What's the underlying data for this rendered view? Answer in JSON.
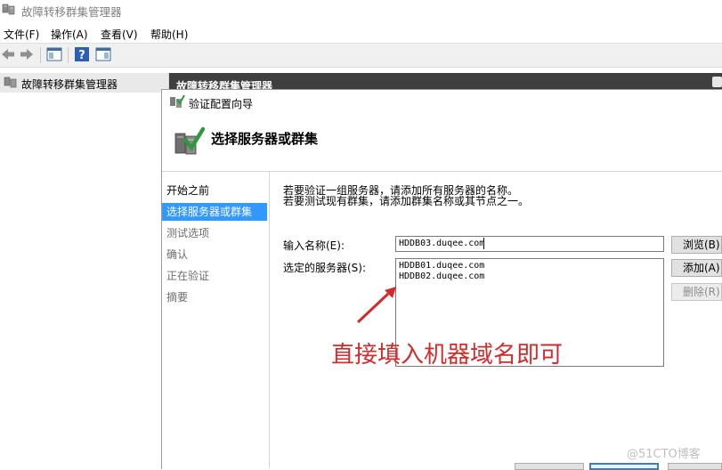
{
  "window": {
    "title": "故障转移群集管理器"
  },
  "menu": {
    "items": [
      "文件(F)",
      "操作(A)",
      "查看(V)",
      "帮助(H)"
    ]
  },
  "toolbar": {
    "icons": [
      "back-arrow-icon",
      "forward-arrow-icon",
      "show-hide-tree-icon",
      "help-icon",
      "action-pane-icon"
    ]
  },
  "tree": {
    "root_label": "故障转移群集管理器"
  },
  "right_pane": {
    "header": "故障转移群集管理器"
  },
  "wizard": {
    "title": "验证配置向导",
    "heading": "选择服务器或群集",
    "steps": [
      {
        "label": "开始之前",
        "state": "done"
      },
      {
        "label": "选择服务器或群集",
        "state": "active"
      },
      {
        "label": "测试选项",
        "state": "pending"
      },
      {
        "label": "确认",
        "state": "pending"
      },
      {
        "label": "正在验证",
        "state": "pending"
      },
      {
        "label": "摘要",
        "state": "pending"
      }
    ],
    "description_line1": "若要验证一组服务器，请添加所有服务器的名称。",
    "description_line2": "若要测试现有群集，请添加群集名称或其节点之一。",
    "name_label": "输入名称(E):",
    "name_value": "HDDB03.duqee.com",
    "selected_label": "选定的服务器(S):",
    "selected_servers": [
      "HDDB01.duqee.com",
      "HDDB02.duqee.com"
    ],
    "browse_button": "浏览(B)...",
    "add_button": "添加(A)",
    "remove_button": "删除(R)"
  },
  "annotation": {
    "text": "直接填入机器域名即可",
    "color": "#d22b2b"
  },
  "watermark": "@51CTO博客",
  "colors": {
    "selection": "#3399ff",
    "header_dark": "#3f3f3f"
  }
}
